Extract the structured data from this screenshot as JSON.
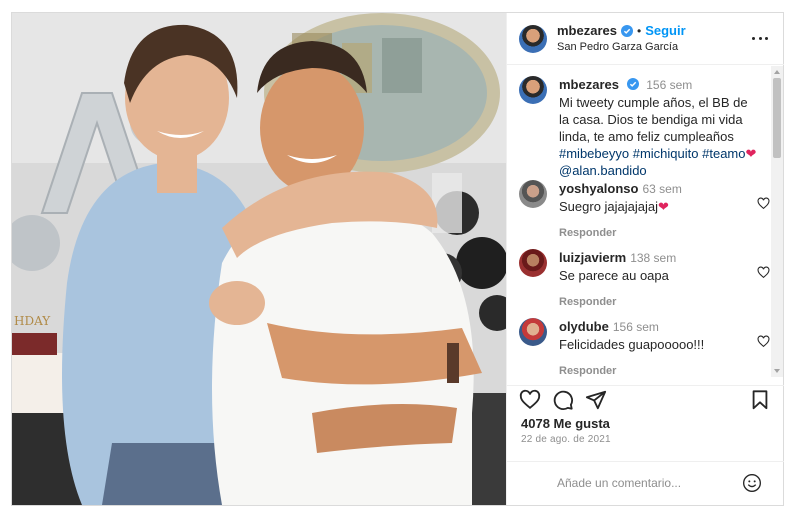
{
  "post": {
    "username": "mbezares",
    "follow_label": "Seguir",
    "dot": "•",
    "location": "San Pedro Garza García"
  },
  "caption": {
    "username": "mbezares",
    "time": "156 sem",
    "text_before": "Mi tweety cumple años, el BB de la casa. Dios te bendiga mi vida linda, te amo feliz cumpleaños ",
    "hashtag1": "#mibebeyyo",
    "hashtag2": "#michiquito",
    "hashtag3": "#teamo",
    "heart": "❤",
    "mention": "@alan.bandido"
  },
  "comments": [
    {
      "user": "yoshyalonso",
      "time": "63 sem",
      "text": "Suegro jajajajajaj",
      "heart": "❤",
      "reply": "Responder"
    },
    {
      "user": "luizjavierm",
      "time": "138 sem",
      "text": "Se parece au oapa",
      "reply": "Responder"
    },
    {
      "user": "olydube",
      "time": "156 sem",
      "text": "Felicidades guapooooo!!!",
      "reply": "Responder"
    }
  ],
  "stats": {
    "likes": "4078 Me gusta",
    "date": "22 de ago. de 2021"
  },
  "add_comment": {
    "placeholder": "Añade un comentario..."
  },
  "colors": {
    "accent": "#0095f6",
    "verified": "#3897f0",
    "heart": "#e0245e",
    "hashtag": "#00376b",
    "muted": "#8e8e8e"
  },
  "icons": [
    "verified-icon",
    "more-options-icon",
    "like-icon",
    "comment-icon",
    "share-icon",
    "save-icon",
    "emoji-icon",
    "comment-like-icon"
  ]
}
